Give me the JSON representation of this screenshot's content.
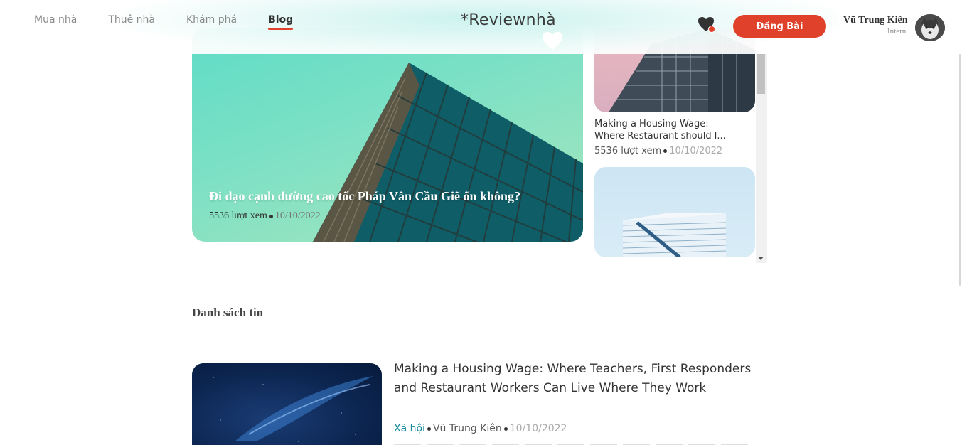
{
  "nav": {
    "items": [
      {
        "label": "Mua nhà",
        "active": false
      },
      {
        "label": "Thuê nhà",
        "active": false
      },
      {
        "label": "Khám phá",
        "active": false
      },
      {
        "label": "Blog",
        "active": true
      }
    ]
  },
  "logo": {
    "text": "*Reviewnhà"
  },
  "header": {
    "post_button": "Đăng Bài"
  },
  "user": {
    "name": "Vũ Trung Kiên",
    "role": "Intern"
  },
  "colors": {
    "accent": "#e0412b",
    "category": "#148a9a"
  },
  "featured": {
    "title": "Đi dạo cạnh đường cao tốc Pháp Vân Cầu Giẽ ổn không?",
    "views": "5536 lượt xem",
    "date": "10/10/2022"
  },
  "side_list": {
    "items": [
      {
        "title_line1": "Making a Housing Wage:",
        "title_line2": "Where Restaurant should l...",
        "views": "5536 lượt xem",
        "date": "10/10/2022"
      }
    ]
  },
  "news": {
    "section_title": "Danh sách tin",
    "items": [
      {
        "title": "Making a Housing Wage: Where Teachers, First Responders and Restaurant Workers Can Live Where They Work",
        "category": "Xã hội",
        "author": "Vũ Trung Kiên",
        "date": "10/10/2022"
      }
    ]
  },
  "icons": {
    "favorite": "heart-icon",
    "logo_mark": "heart-icon",
    "scroll_down": "triangle-down-icon"
  }
}
